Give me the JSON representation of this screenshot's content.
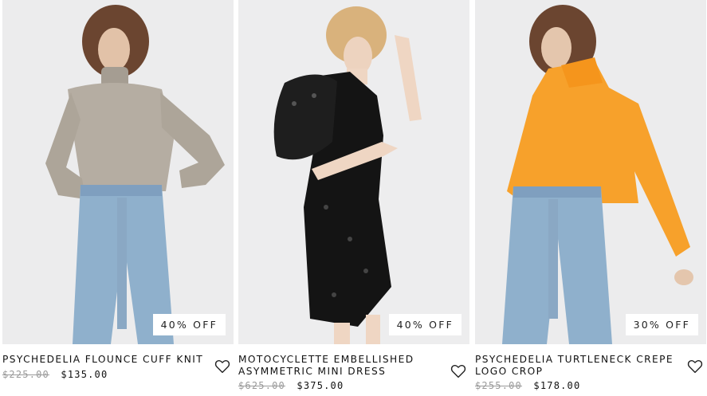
{
  "products": [
    {
      "name": "PSYCHEDELIA FLOUNCE CUFF KNIT",
      "old_price": "$225.00",
      "sale_price": "$135.00",
      "badge": "40% OFF",
      "image_icon": "model-wearing-knit-photo"
    },
    {
      "name": "MOTOCYCLETTE EMBELLISHED ASYMMETRIC MINI DRESS",
      "old_price": "$625.00",
      "sale_price": "$375.00",
      "badge": "40% OFF",
      "image_icon": "model-wearing-dress-photo"
    },
    {
      "name": "PSYCHEDELIA TURTLENECK CREPE LOGO CROP",
      "old_price": "$255.00",
      "sale_price": "$178.00",
      "badge": "30% OFF",
      "image_icon": "model-wearing-orange-top-photo"
    }
  ],
  "icons": {
    "wishlist": "heart-outline-icon"
  },
  "colors": {
    "background": "#ffffff",
    "photo_bg": "#eeeeef",
    "accent_orange": "#f7a12b"
  }
}
